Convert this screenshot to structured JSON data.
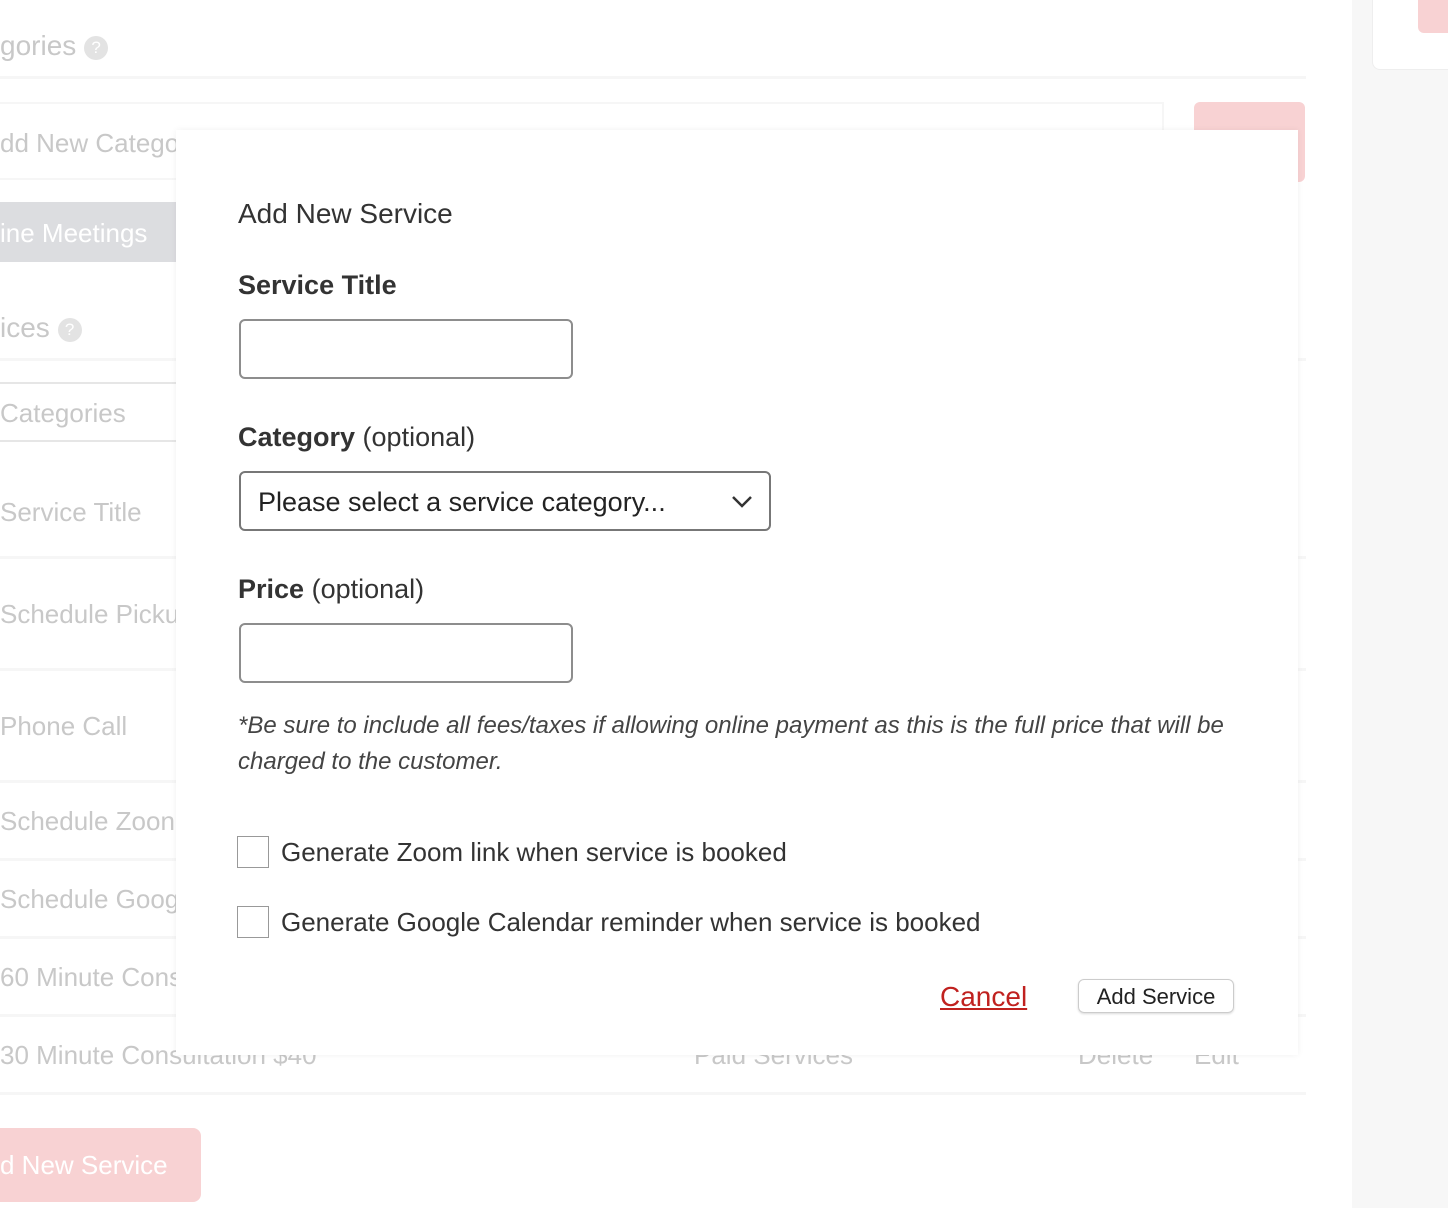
{
  "background": {
    "categories_heading": "gories",
    "add_category_placeholder": "dd New Catego",
    "category_tab": "ine Meetings",
    "services_heading": "ices",
    "categories_tab": "Categories",
    "column_service_title": "Service Title",
    "rows": [
      {
        "title": "Schedule Picku"
      },
      {
        "title": "Phone Call"
      },
      {
        "title": "Schedule Zoon"
      },
      {
        "title": "Schedule Goog"
      },
      {
        "title": "60 Minute Cons"
      },
      {
        "title": "30 Minute Consultation $40",
        "category": "Paid Services",
        "delete": "Delete",
        "edit": "Edit"
      }
    ],
    "add_service_button": "d New Service"
  },
  "modal": {
    "title": "Add New Service",
    "service_title_label": "Service Title",
    "service_title_value": "",
    "category_label": "Category",
    "optional": "(optional)",
    "category_select": "Please select a service category...",
    "price_label": "Price",
    "price_value": "",
    "price_note": "*Be sure to include all fees/taxes if allowing online payment as this is the full price that will be charged to the customer.",
    "zoom_checkbox": "Generate Zoom link when service is booked",
    "google_checkbox": "Generate Google Calendar reminder when service is booked",
    "zoom_checked": false,
    "google_checked": false,
    "cancel": "Cancel",
    "submit": "Add Service"
  },
  "colors": {
    "accent": "#f8d2d3",
    "cancel": "#c0211f"
  }
}
